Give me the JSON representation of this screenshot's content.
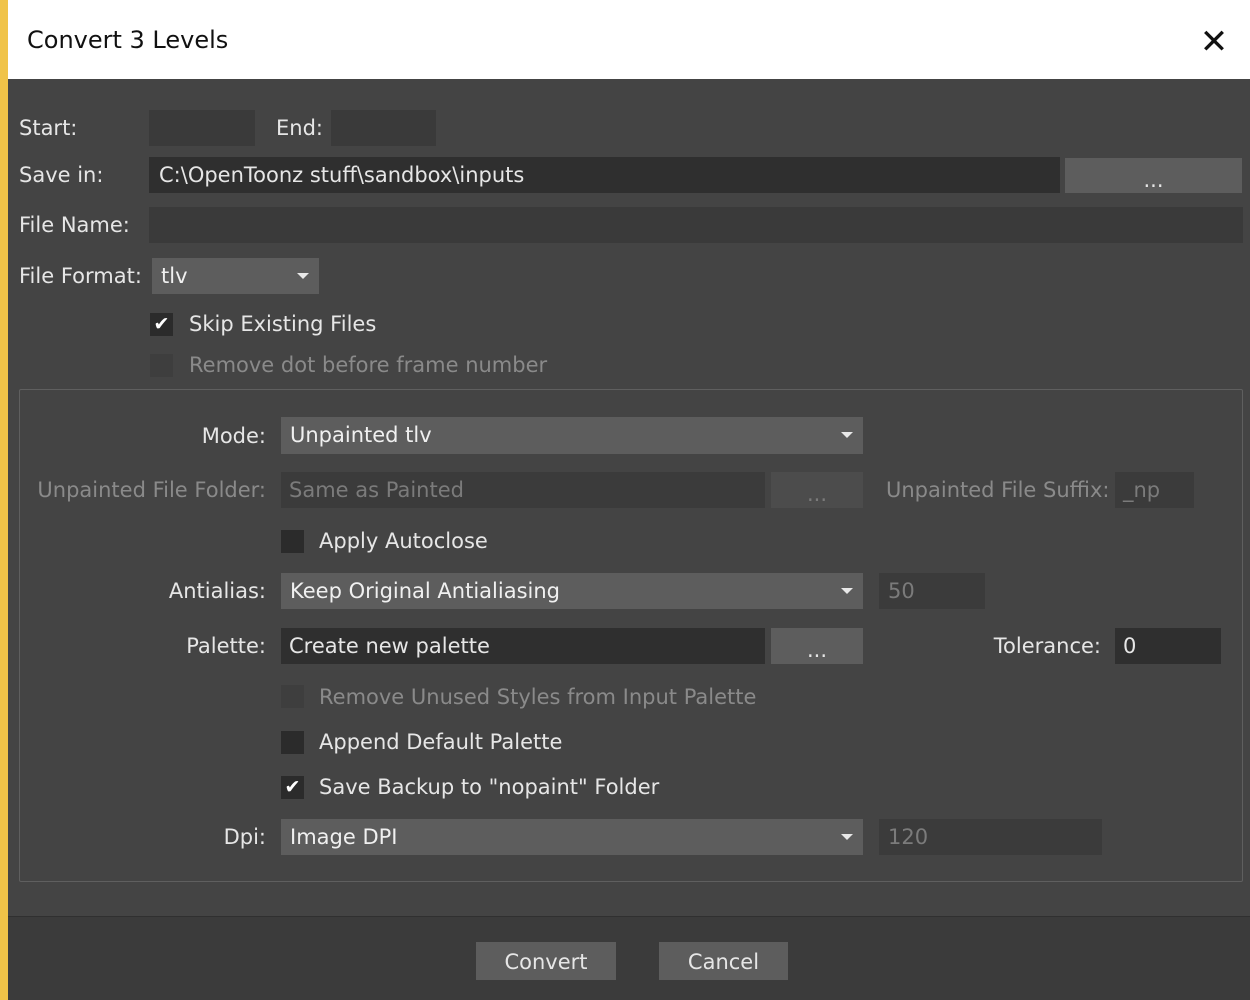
{
  "window": {
    "title": "Convert 3 Levels",
    "close_glyph": "✕"
  },
  "range": {
    "start_label": "Start:",
    "start_value": "",
    "end_label": "End:",
    "end_value": ""
  },
  "save_in": {
    "label": "Save in:",
    "value": "C:\\OpenToonz stuff\\sandbox\\inputs",
    "browse_label": "..."
  },
  "file_name": {
    "label": "File Name:",
    "value": ""
  },
  "file_format": {
    "label": "File Format:",
    "value": "tlv"
  },
  "skip_existing": {
    "label": "Skip Existing Files",
    "checked": true
  },
  "remove_dot": {
    "label": "Remove dot before frame number",
    "checked": false,
    "enabled": false
  },
  "options": {
    "mode": {
      "label": "Mode:",
      "value": "Unpainted tlv"
    },
    "unpainted_folder": {
      "label": "Unpainted File Folder:",
      "value": "Same as Painted",
      "browse_label": "..."
    },
    "unpainted_suffix": {
      "label": "Unpainted File Suffix:",
      "value": "_np"
    },
    "apply_autoclose": {
      "label": "Apply Autoclose",
      "checked": false
    },
    "antialias": {
      "label": "Antialias:",
      "value": "Keep Original Antialiasing",
      "amount": "50"
    },
    "palette": {
      "label": "Palette:",
      "value": "Create new palette",
      "browse_label": "..."
    },
    "tolerance": {
      "label": "Tolerance:",
      "value": "0"
    },
    "remove_unused_styles": {
      "label": "Remove Unused Styles from Input Palette",
      "checked": false,
      "enabled": false
    },
    "append_default_palette": {
      "label": "Append Default Palette",
      "checked": false
    },
    "save_backup": {
      "label": "Save Backup to \"nopaint\" Folder",
      "checked": true
    },
    "dpi": {
      "label": "Dpi:",
      "value": "Image DPI",
      "amount": "120"
    }
  },
  "buttons": {
    "convert": "Convert",
    "cancel": "Cancel"
  },
  "colors": {
    "accent_edge": "#f0c348",
    "background": "#444444",
    "field": "#2f2f2f",
    "button": "#5d5d5d"
  }
}
